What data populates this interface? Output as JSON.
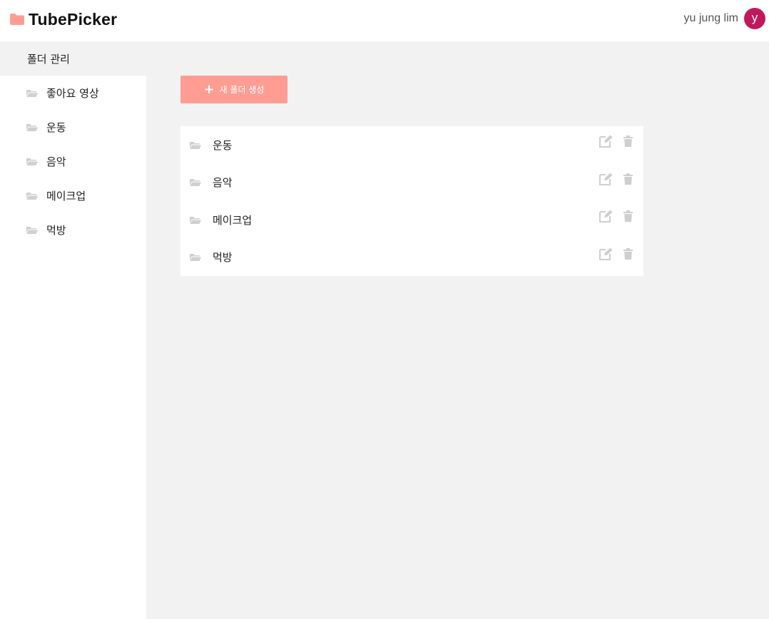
{
  "app": {
    "title": "TubePicker"
  },
  "header": {
    "user_name": "yu jung lim",
    "avatar_initial": "y"
  },
  "sidebar": {
    "heading": "폴더 관리",
    "items": [
      {
        "label": "좋아요 영상"
      },
      {
        "label": "운동"
      },
      {
        "label": "음악"
      },
      {
        "label": "메이크업"
      },
      {
        "label": "먹방"
      }
    ]
  },
  "main": {
    "new_folder_label": "새 폴더 생성",
    "folders": [
      {
        "name": "운동"
      },
      {
        "name": "음악"
      },
      {
        "name": "메이크업"
      },
      {
        "name": "먹방"
      }
    ]
  },
  "colors": {
    "brand": "#ff9d93",
    "avatar": "#c2185b",
    "icon_gray": "#cfcfcf",
    "panel_bg": "#f2f2f2"
  },
  "icons": {
    "logo": "folder-icon",
    "folder": "folder-open-icon",
    "edit": "edit-icon",
    "delete": "trash-icon",
    "add": "plus-icon"
  }
}
